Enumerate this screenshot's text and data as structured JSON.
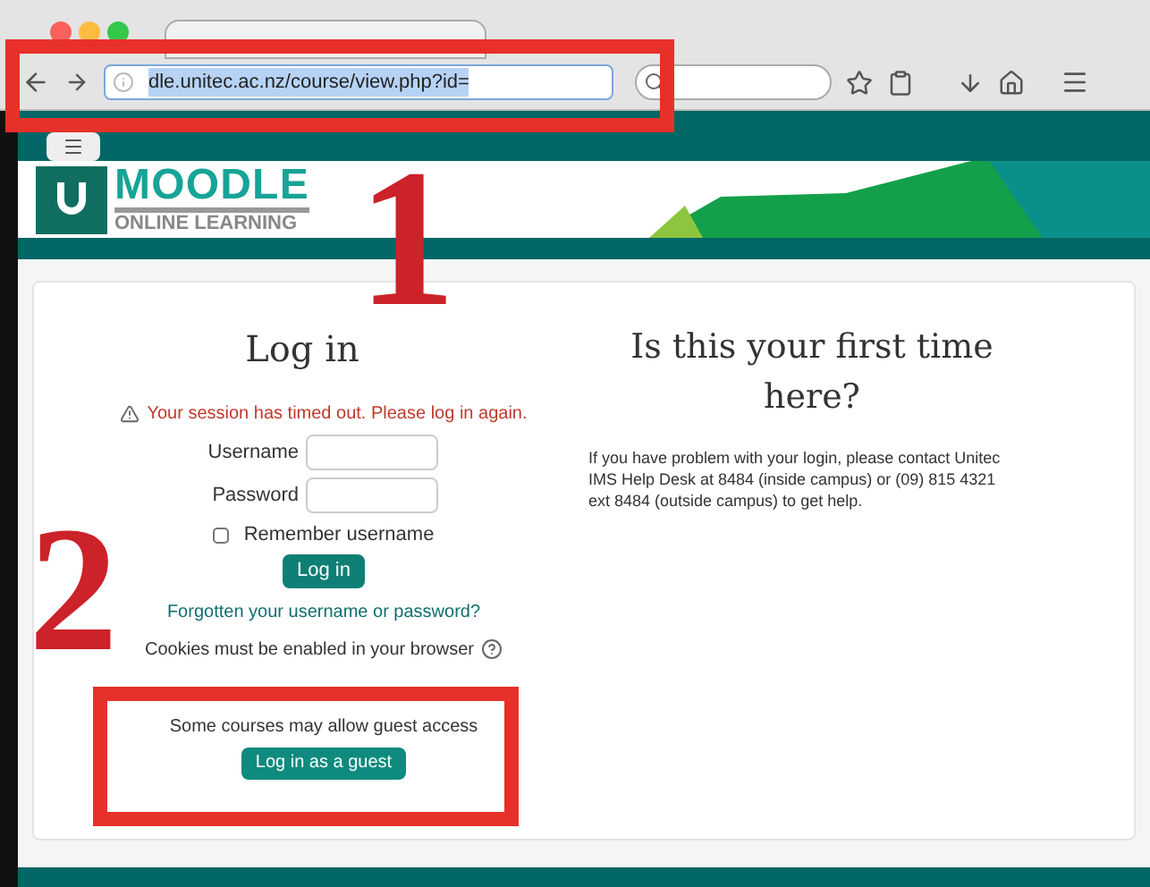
{
  "browser": {
    "url": "dle.unitec.ac.nz/course/view.php?id="
  },
  "logo": {
    "title": "MOODLE",
    "subtitle": "ONLINE LEARNING"
  },
  "login": {
    "title": "Log in",
    "alert": "Your session has timed out. Please log in again.",
    "fields": [
      {
        "label": "Username"
      },
      {
        "label": "Password"
      }
    ],
    "remember": {
      "label": "Remember username",
      "checked": false
    },
    "submit": "Log in",
    "forgot": "Forgotten your username or password?",
    "cookies": "Cookies must be enabled in your browser",
    "guest_note": "Some courses may allow guest access",
    "guest_button": "Log in as a guest"
  },
  "first_time": {
    "title": "Is this your first time here?",
    "text": "If you have problem with your login, please contact Unitec IMS Help Desk at 8484 (inside campus) or (09) 815 4321 ext 8484 (outside campus) to get help."
  },
  "annotations": [
    {
      "label": "1"
    },
    {
      "label": "2"
    }
  ]
}
